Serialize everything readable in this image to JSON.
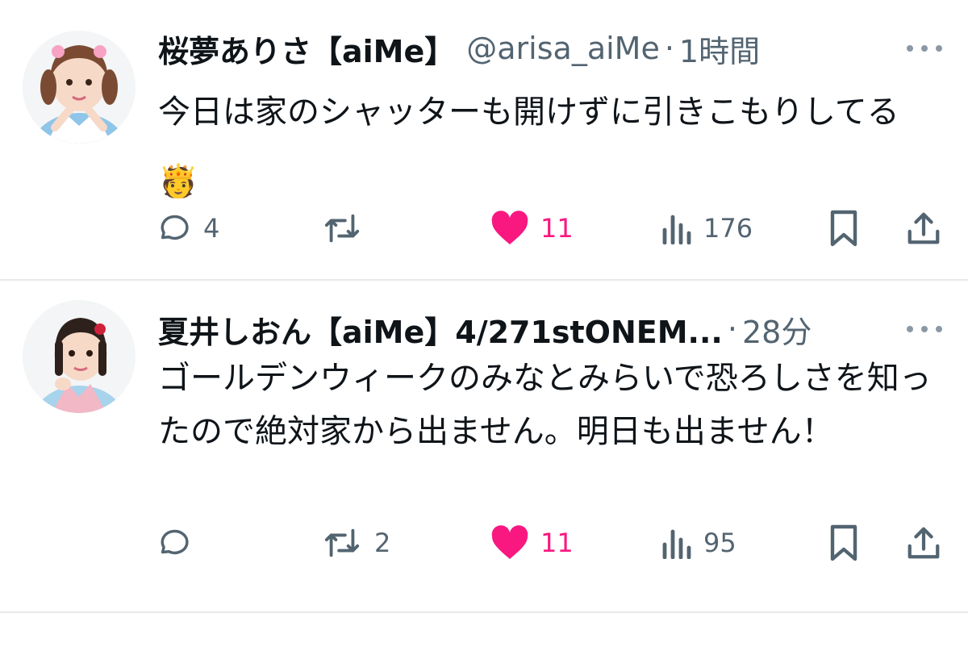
{
  "tweets": [
    {
      "display_name": "桜夢ありさ【aiMe】",
      "handle": "@arisa_aiMe",
      "separator": "·",
      "time": "1時間",
      "text": "今日は家のシャッターも開けずに引きこもりしてる🫅",
      "replies": "4",
      "retweets": "",
      "likes": "11",
      "views": "176",
      "liked": true
    },
    {
      "display_name": "夏井しおん【aiMe】4/271stONEM...",
      "handle": "",
      "separator": "·",
      "time": "28分",
      "text": "ゴールデンウィークのみなとみらいで恐ろしさを知ったので絶対家から出ません。明日も出ません！",
      "replies": "",
      "retweets": "2",
      "likes": "11",
      "views": "95",
      "liked": true
    }
  ],
  "colors": {
    "text": "#0f1419",
    "secondary": "#536471",
    "like": "#f91880",
    "divider": "#e7e9ea"
  },
  "icons": [
    "reply-icon",
    "retweet-icon",
    "heart-icon",
    "views-icon",
    "bookmark-icon",
    "share-icon",
    "more-icon"
  ]
}
